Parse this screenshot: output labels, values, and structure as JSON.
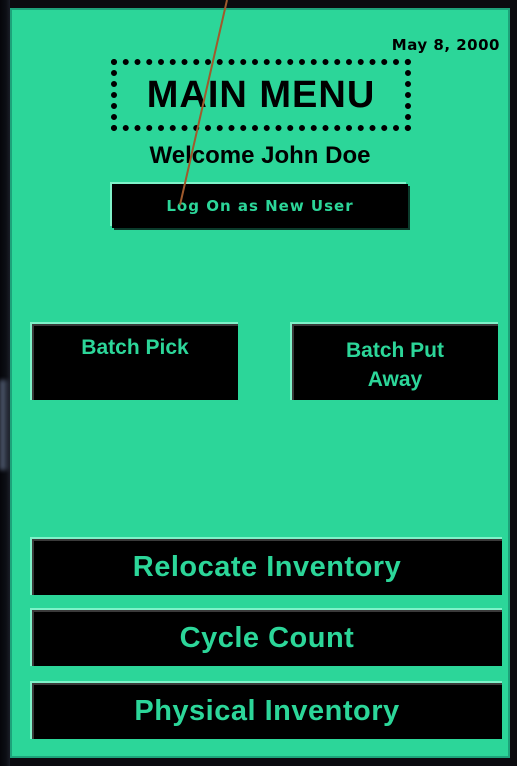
{
  "screen": {
    "date": "May 8, 2000",
    "title": "MAIN MENU",
    "welcome": "Welcome John Doe",
    "logon_label": "Log On as New User",
    "buttons": {
      "batch_pick": "Batch Pick",
      "batch_put_line1": "Batch Put",
      "batch_put_line2": "Away",
      "relocate": "Relocate Inventory",
      "cycle": "Cycle Count",
      "physical": "Physical Inventory"
    }
  },
  "colors": {
    "screen_bg": "#2cd699",
    "button_bg": "#000000",
    "button_text": "#2cd699"
  }
}
